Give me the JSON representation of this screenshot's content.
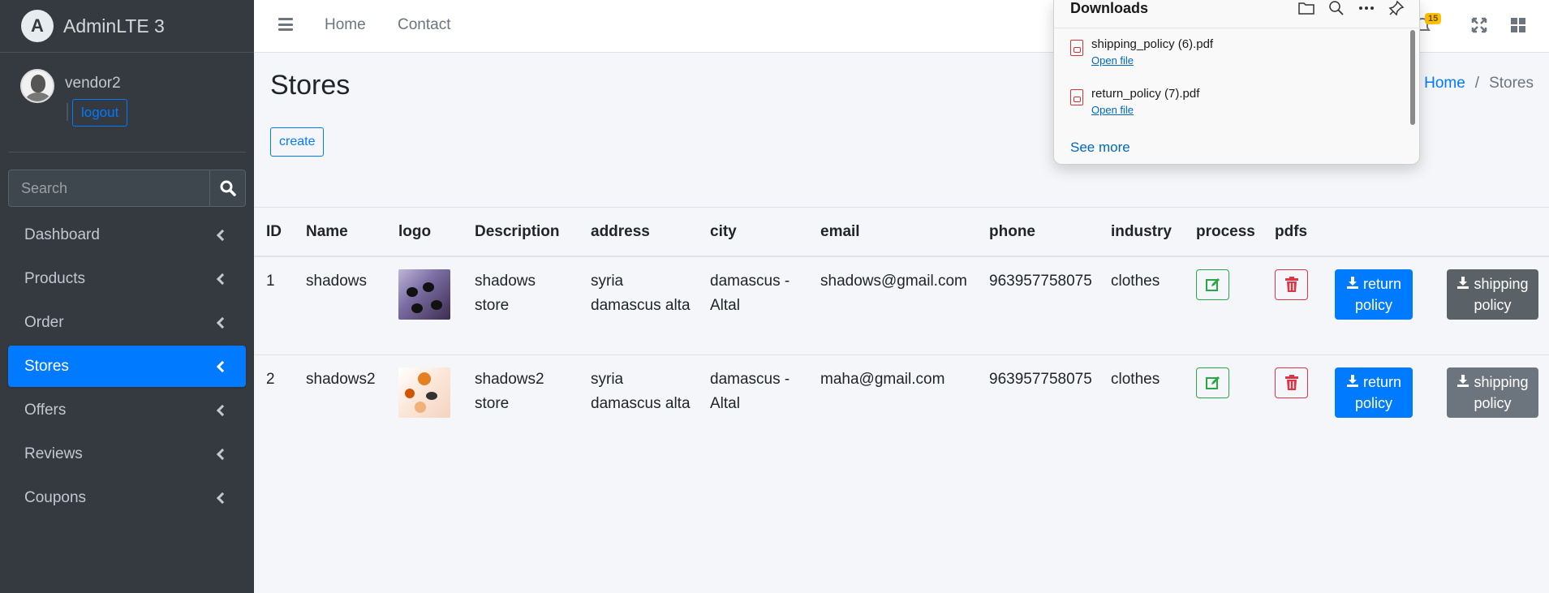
{
  "brand": {
    "name": "AdminLTE 3"
  },
  "user": {
    "name": "vendor2",
    "logout_label": "logout"
  },
  "search": {
    "placeholder": "Search"
  },
  "sidebar": {
    "items": [
      {
        "label": "Dashboard",
        "active": false
      },
      {
        "label": "Products",
        "active": false
      },
      {
        "label": "Order",
        "active": false
      },
      {
        "label": "Stores",
        "active": true
      },
      {
        "label": "Offers",
        "active": false
      },
      {
        "label": "Reviews",
        "active": false
      },
      {
        "label": "Coupons",
        "active": false
      }
    ]
  },
  "topbar": {
    "links": [
      "Home",
      "Contact"
    ],
    "notification_count": "15"
  },
  "page": {
    "title": "Stores",
    "create_label": "create",
    "breadcrumb": {
      "home": "Home",
      "separator": "/",
      "current": "Stores"
    }
  },
  "table": {
    "headers": [
      "ID",
      "Name",
      "logo",
      "Description",
      "address",
      "city",
      "email",
      "phone",
      "industry",
      "process",
      "pdfs"
    ],
    "rows": [
      {
        "id": "1",
        "name": "shadows",
        "description": "shadows store",
        "address": "syria damascus alta",
        "city": "damascus - Altal",
        "email": "shadows@gmail.com",
        "phone": "963957758075",
        "industry": "clothes",
        "return_label": "return policy",
        "shipping_label": "shipping policy"
      },
      {
        "id": "2",
        "name": "shadows2",
        "description": "shadows2 store",
        "address": "syria damascus alta",
        "city": "damascus - Altal",
        "email": "maha@gmail.com",
        "phone": "963957758075",
        "industry": "clothes",
        "return_label": "return policy",
        "shipping_label": "shipping policy"
      }
    ]
  },
  "downloads": {
    "title": "Downloads",
    "items": [
      {
        "file": "shipping_policy (6).pdf",
        "action": "Open file"
      },
      {
        "file": "return_policy (7).pdf",
        "action": "Open file"
      }
    ],
    "see_more": "See more"
  },
  "colors": {
    "sidebar_bg": "#343a40",
    "primary": "#007bff",
    "success": "#28a745",
    "danger": "#dc3545",
    "secondary": "#6c757d",
    "warning": "#ffc107"
  }
}
